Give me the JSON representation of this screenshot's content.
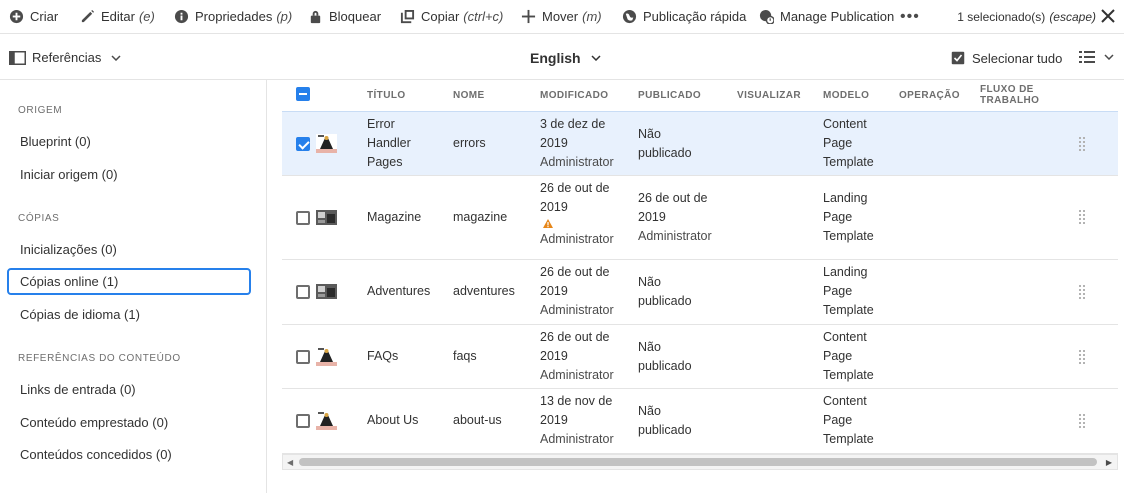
{
  "actionbar": {
    "create": "Criar",
    "edit": "Editar",
    "edit_key": "(e)",
    "properties": "Propriedades",
    "properties_key": "(p)",
    "lock": "Bloquear",
    "copy": "Copiar",
    "copy_key": "(ctrl+c)",
    "move": "Mover",
    "move_key": "(m)",
    "quick_publish": "Publicação rápida",
    "manage_publication": "Manage Publication",
    "more": "•••",
    "selection_count": "1 selecionado(s)",
    "selection_key": "(escape)"
  },
  "rail": {
    "title": "Referências",
    "sections": [
      {
        "label": "ORIGEM",
        "items": [
          "Blueprint (0)",
          "Iniciar origem (0)"
        ]
      },
      {
        "label": "CÓPIAS",
        "items": [
          "Inicializações (0)",
          "Cópias online (1)",
          "Cópias de idioma (1)"
        ]
      },
      {
        "label": "REFERÊNCIAS DO CONTEÚDO",
        "items": [
          "Links de entrada (0)",
          "Conteúdo emprestado (0)",
          "Conteúdos concedidos (0)"
        ]
      }
    ]
  },
  "header": {
    "language": "English",
    "select_all": "Selecionar tudo"
  },
  "table": {
    "columns": [
      "TÍTULO",
      "NOME",
      "MODIFICADO",
      "PUBLICADO",
      "VISUALIZAR",
      "MODELO",
      "OPERAÇÃO",
      "FLUXO DE",
      "TRABALHO"
    ],
    "rows": [
      {
        "title": [
          "Error",
          "Handler",
          "Pages"
        ],
        "name": "errors",
        "modified": [
          "3 de dez de",
          "2019",
          "Administrator"
        ],
        "published": [
          "Não",
          "publicado"
        ],
        "template": [
          "Content",
          "Page",
          "Template"
        ],
        "selected": true
      },
      {
        "title": [
          "Magazine"
        ],
        "name": "magazine",
        "modified": [
          "26 de out de",
          "2019",
          "Administrator"
        ],
        "published": [
          "26 de out de",
          "2019",
          "Administrator"
        ],
        "template": [
          "Landing",
          "Page",
          "Template"
        ],
        "selected": false,
        "warning": true
      },
      {
        "title": [
          "Adventures"
        ],
        "name": "adventures",
        "modified": [
          "26 de out de",
          "2019",
          "Administrator"
        ],
        "published": [
          "Não",
          "publicado"
        ],
        "template": [
          "Landing",
          "Page",
          "Template"
        ],
        "selected": false
      },
      {
        "title": [
          "FAQs"
        ],
        "name": "faqs",
        "modified": [
          "26 de out de",
          "2019",
          "Administrator"
        ],
        "published": [
          "Não",
          "publicado"
        ],
        "template": [
          "Content",
          "Page",
          "Template"
        ],
        "selected": false
      },
      {
        "title": [
          "About Us"
        ],
        "name": "about-us",
        "modified": [
          "13 de nov de",
          "2019",
          "Administrator"
        ],
        "published": [
          "Não",
          "publicado"
        ],
        "template": [
          "Content",
          "Page",
          "Template"
        ],
        "selected": false
      }
    ]
  },
  "colors": {
    "accent": "#2680eb",
    "selected_row": "#e8f1fd",
    "warning": "#e68619"
  }
}
